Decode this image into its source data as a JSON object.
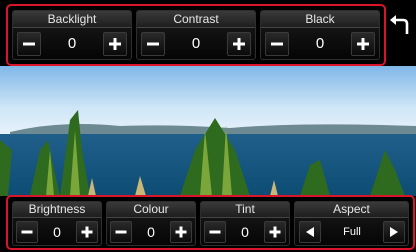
{
  "top_panel": {
    "groups": [
      {
        "label": "Backlight",
        "value": "0"
      },
      {
        "label": "Contrast",
        "value": "0"
      },
      {
        "label": "Black",
        "value": "0"
      }
    ]
  },
  "bottom_panel": {
    "groups": [
      {
        "label": "Brightness",
        "value": "0"
      },
      {
        "label": "Colour",
        "value": "0"
      },
      {
        "label": "Tint",
        "value": "0"
      }
    ],
    "aspect": {
      "label": "Aspect",
      "value": "Full"
    }
  },
  "icons": {
    "decrease": "minus-icon",
    "increase": "plus-icon",
    "previous": "left-arrow-icon",
    "next": "right-arrow-icon",
    "back": "back-arrow-icon"
  },
  "colors": {
    "highlight_border": "#d9142b",
    "text": "#ffffff"
  }
}
